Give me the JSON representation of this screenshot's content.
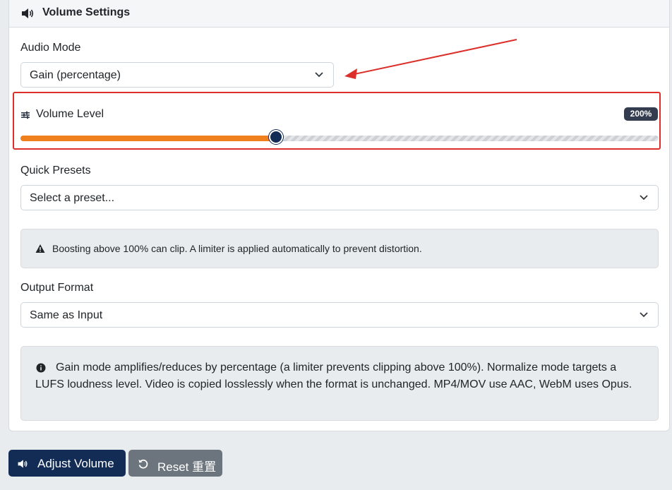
{
  "header": {
    "title": "Volume Settings",
    "icon": "speaker-icon"
  },
  "audio_mode": {
    "label": "Audio Mode",
    "selected": "Gain (percentage)"
  },
  "volume": {
    "label": "Volume Level",
    "badge": "200%",
    "slider_fraction": 0.402,
    "fill_color": "#f07f1d",
    "thumb_color": "#132c55"
  },
  "presets": {
    "label": "Quick Presets",
    "selected": "Select a preset..."
  },
  "warning": {
    "text": "Boosting above 100% can clip. A limiter is applied automatically to prevent distortion."
  },
  "output_format": {
    "label": "Output Format",
    "selected": "Same as Input"
  },
  "info": {
    "text": "Gain mode amplifies/reduces by percentage (a limiter prevents clipping above 100%). Normalize mode targets a LUFS loudness level. Video is copied losslessly when the format is unchanged. MP4/MOV use AAC, WebM uses Opus."
  },
  "buttons": {
    "adjust": "Adjust Volume",
    "reset": "Reset 重置"
  },
  "colors": {
    "primary": "#132c55",
    "secondary": "#6c757d",
    "annotation": "#dc2f2a"
  }
}
